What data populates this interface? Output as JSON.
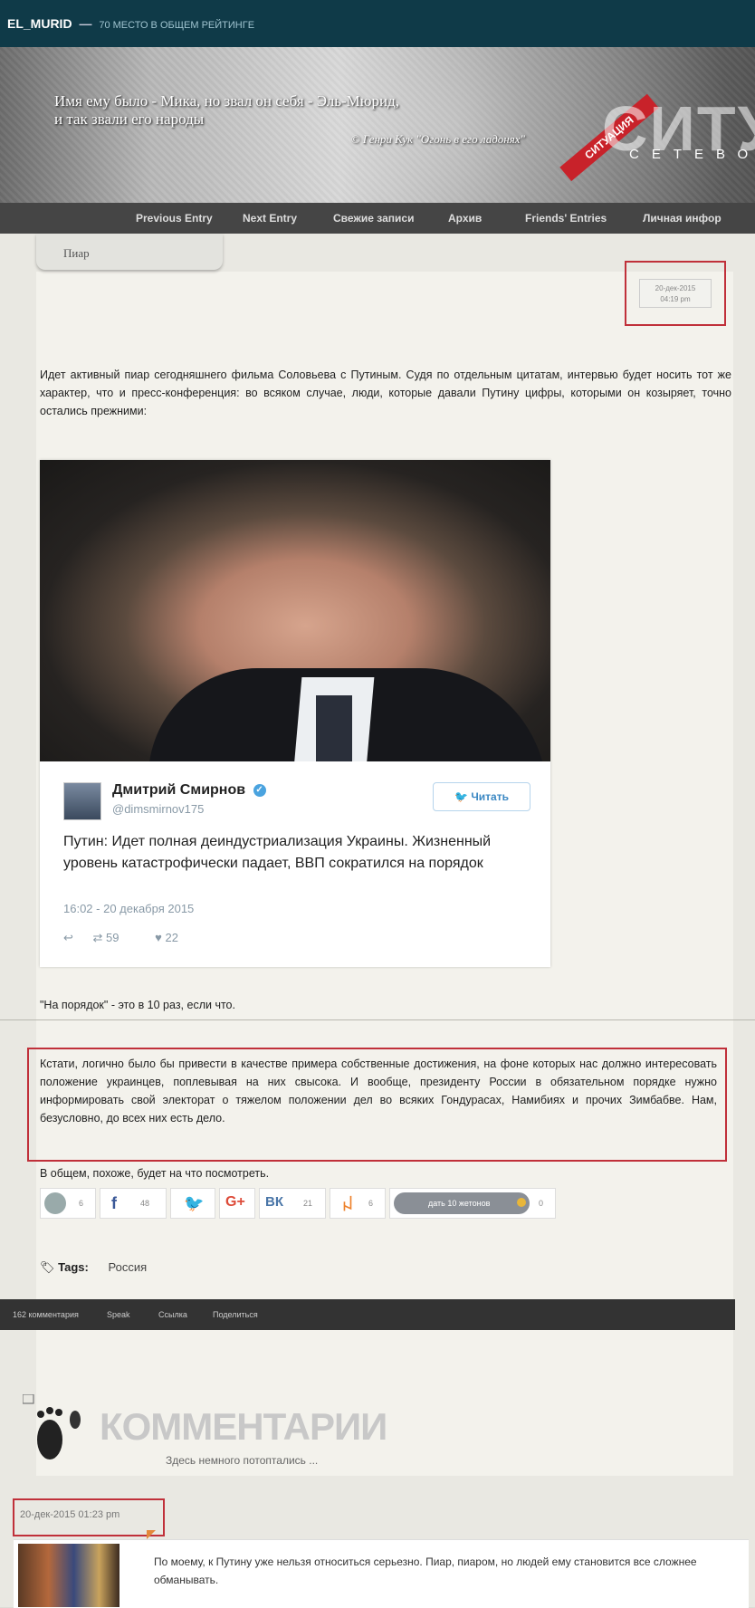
{
  "header": {
    "username": "EL_MURID",
    "separator": "—",
    "rating": "70 МЕСТО В ОБЩЕМ РЕЙТИНГЕ"
  },
  "banner": {
    "quote_line1": "Имя ему было - Мика, но звал он себя - Эль-Мюрид,",
    "quote_line2": "и так звали его народы",
    "quote_source": "© Генри Кук \"Огонь в его ладонях\"",
    "ribbon": "СИТУАЦИЯ",
    "big_word": "СИТУ",
    "small_word": "СЕТЕВО"
  },
  "nav": {
    "items": [
      "Previous Entry",
      "Next Entry",
      "Свежие записи",
      "Архив",
      "Friends' Entries",
      "Личная инфор"
    ]
  },
  "post": {
    "subject": "Пиар",
    "date": "20-дек-2015",
    "time": "04:19 pm",
    "intro": "Идет активный пиар сегодняшнего фильма Соловьева с Путиным. Судя по отдельным цитатам, интервью будет носить тот же характер, что и пресс-конференция: во всяком случае, люди, которые давали Путину цифры, которыми он козыряет, точно остались прежними:",
    "tweet": {
      "name": "Дмитрий Смирнов",
      "verified": "✓",
      "handle": "@dimsmirnov175",
      "follow": "Читать",
      "text": "Путин: Идет полная деиндустриализация Украины. Жизненный уровень катастрофически падает, ВВП сократился на порядок",
      "time": "16:02 - 20 декабря 2015",
      "reply_icon": "reply-icon",
      "retweets": "59",
      "likes": "22"
    },
    "note": "\"На порядок\" - это в 10 раз, если что.",
    "highlight": "Кстати, логично было бы привести в качестве примера собственные достижения, на фоне которых нас должно интересовать положение украинцев, поплевывая на них свысока. И вообще, президенту России в обязательном порядке нужно информировать свой электорат о тяжелом положении дел во всяких Гондурасах, Намибиях и прочих Зимбабве. Нам, безусловно, до всех них есть дело.",
    "closing": "В общем, похоже, будет на что посмотреть.",
    "share": {
      "lj": "6",
      "fb_label": "f",
      "fb": "48",
      "gplus_label": "G+",
      "vk_label": "ВК",
      "vk": "21",
      "ok": "6",
      "tokens_label": "дать 10 жетонов",
      "tokens": "0"
    },
    "tags_label": "Tags:",
    "tag": "Россия"
  },
  "actionbar": {
    "comments": "162 комментария",
    "speak": "Speak",
    "link": "Ссылка",
    "share": "Поделиться"
  },
  "comments": {
    "title": "КОММЕНТАРИИ",
    "subtitle": "Здесь немного потоптались ...",
    "first": {
      "date": "20-дек-2015 01:23 pm",
      "text": "По моему, к Путину уже нельзя относиться серьезно. Пиар, пиаром, но людей ему становится все сложнее обманывать."
    }
  },
  "colors": {
    "topbar": "#0f3a48",
    "highlight_border": "#c0303a",
    "twitter_blue": "#4aa3df",
    "fb": "#3b5998",
    "twitter": "#55acee",
    "gplus": "#dd4b39",
    "vk": "#4a76a8",
    "ok": "#ed812b"
  }
}
